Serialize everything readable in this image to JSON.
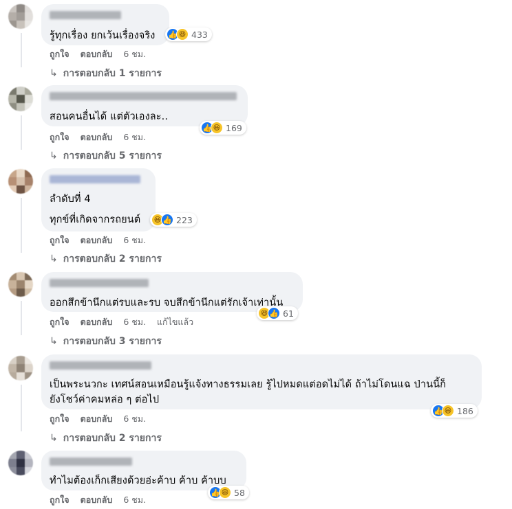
{
  "comments": [
    {
      "avatar_colors": [
        "#c9c4bf",
        "#8f8a86",
        "#dedbd8",
        "#b4aea8",
        "#a29d98",
        "#e2dfdc",
        "#9c968f",
        "#c8c2bb",
        "#e8e6e3"
      ],
      "name_color": "#b0b3b8",
      "lines": [
        "รู้ทุกเรื่อง ยกเว้นเรื่องจริง"
      ],
      "reactions": [
        "like",
        "haha"
      ],
      "reaction_count": "433",
      "actions": [
        "ถูกใจ",
        "ตอบกลับ"
      ],
      "time": "6 ชม.",
      "edited": "",
      "replies": "การตอบกลับ 1 รายการ"
    },
    {
      "avatar_colors": [
        "#7a7a6e",
        "#cfcfc8",
        "#a8a89b",
        "#b6b6aa",
        "#55564b",
        "#dcdcd5",
        "#8e8e82",
        "#c4c4ba",
        "#e8e8e4"
      ],
      "name_color": "#b0b3b8",
      "lines": [
        "สอนคนอื่นได้ แต่ตัวเองละ.."
      ],
      "reactions": [
        "like",
        "haha"
      ],
      "reaction_count": "169",
      "actions": [
        "ถูกใจ",
        "ตอบกลับ"
      ],
      "time": "6 ชม.",
      "edited": "",
      "replies": "การตอบกลับ 5 รายการ"
    },
    {
      "avatar_colors": [
        "#c7a68a",
        "#e9d9c7",
        "#8f6b52",
        "#b79075",
        "#d6c0ab",
        "#a7826a",
        "#e3cbb6",
        "#6f5444",
        "#cdb39c"
      ],
      "name_color": "#aab6d6",
      "lines": [
        "ลำดับที่ 4",
        "ทุกข์ที่เกิดจากรถยนต์"
      ],
      "reactions": [
        "haha",
        "like"
      ],
      "reaction_count": "223",
      "actions": [
        "ถูกใจ",
        "ตอบกลับ"
      ],
      "time": "6 ชม.",
      "edited": "",
      "replies": "การตอบกลับ 2 รายการ"
    },
    {
      "avatar_colors": [
        "#a38b72",
        "#d8c6b1",
        "#7d6a57",
        "#c8b29a",
        "#9b846d",
        "#e4d6c5",
        "#b59c83",
        "#6e5c4b",
        "#d0bda6"
      ],
      "name_color": "#b0b3b8",
      "lines": [
        "ออกสึกข้านึกแต่รบและรบ จบสึกข้านึกแต่รักเจ้าเท่านั้น"
      ],
      "reactions": [
        "haha",
        "like"
      ],
      "reaction_count": "61",
      "actions": [
        "ถูกใจ",
        "ตอบกลับ"
      ],
      "time": "6 ชม.",
      "edited": "แก้ไขแล้ว",
      "replies": "การตอบกลับ 3 รายการ"
    },
    {
      "avatar_colors": [
        "#d8d0c6",
        "#a89d90",
        "#ece7e1",
        "#c2b6a8",
        "#8f8376",
        "#dcd4ca",
        "#b7ab9d",
        "#e6e0d9",
        "#9d9184"
      ],
      "name_color": "#b0b3b8",
      "lines": [
        "เป็นพระนวกะ เทศน์สอนเหมือนรู้แจ้งทางธรรมเลย รู้ไปหมดแต่อดไม่ได้ ถ้าไม่โดนแฉ ป่านนี้ก็",
        "ยังโชว์ค่าคมหล่อ ๆ ต่อไป"
      ],
      "reactions": [
        "like",
        "haha"
      ],
      "reaction_count": "186",
      "actions": [
        "ถูกใจ",
        "ตอบกลับ"
      ],
      "time": "6 ชม.",
      "edited": "",
      "replies": "การตอบกลับ 2 รายการ"
    },
    {
      "avatar_colors": [
        "#a4a6b0",
        "#5e6072",
        "#c9cad2",
        "#7d7f8e",
        "#2f3142",
        "#b4b5bf",
        "#8d8f9c",
        "#4a4c5e",
        "#d7d8de"
      ],
      "name_color": "#b0b3b8",
      "lines": [
        "ทำไมต้องเก็กเสียงด้วยอ่ะค้าบ ค้าบ ค้าบบ"
      ],
      "reactions": [
        "like",
        "haha"
      ],
      "reaction_count": "58",
      "actions": [
        "ถูกใจ",
        "ตอบกลับ"
      ],
      "time": "6 ชม.",
      "edited": "",
      "replies": ""
    }
  ]
}
